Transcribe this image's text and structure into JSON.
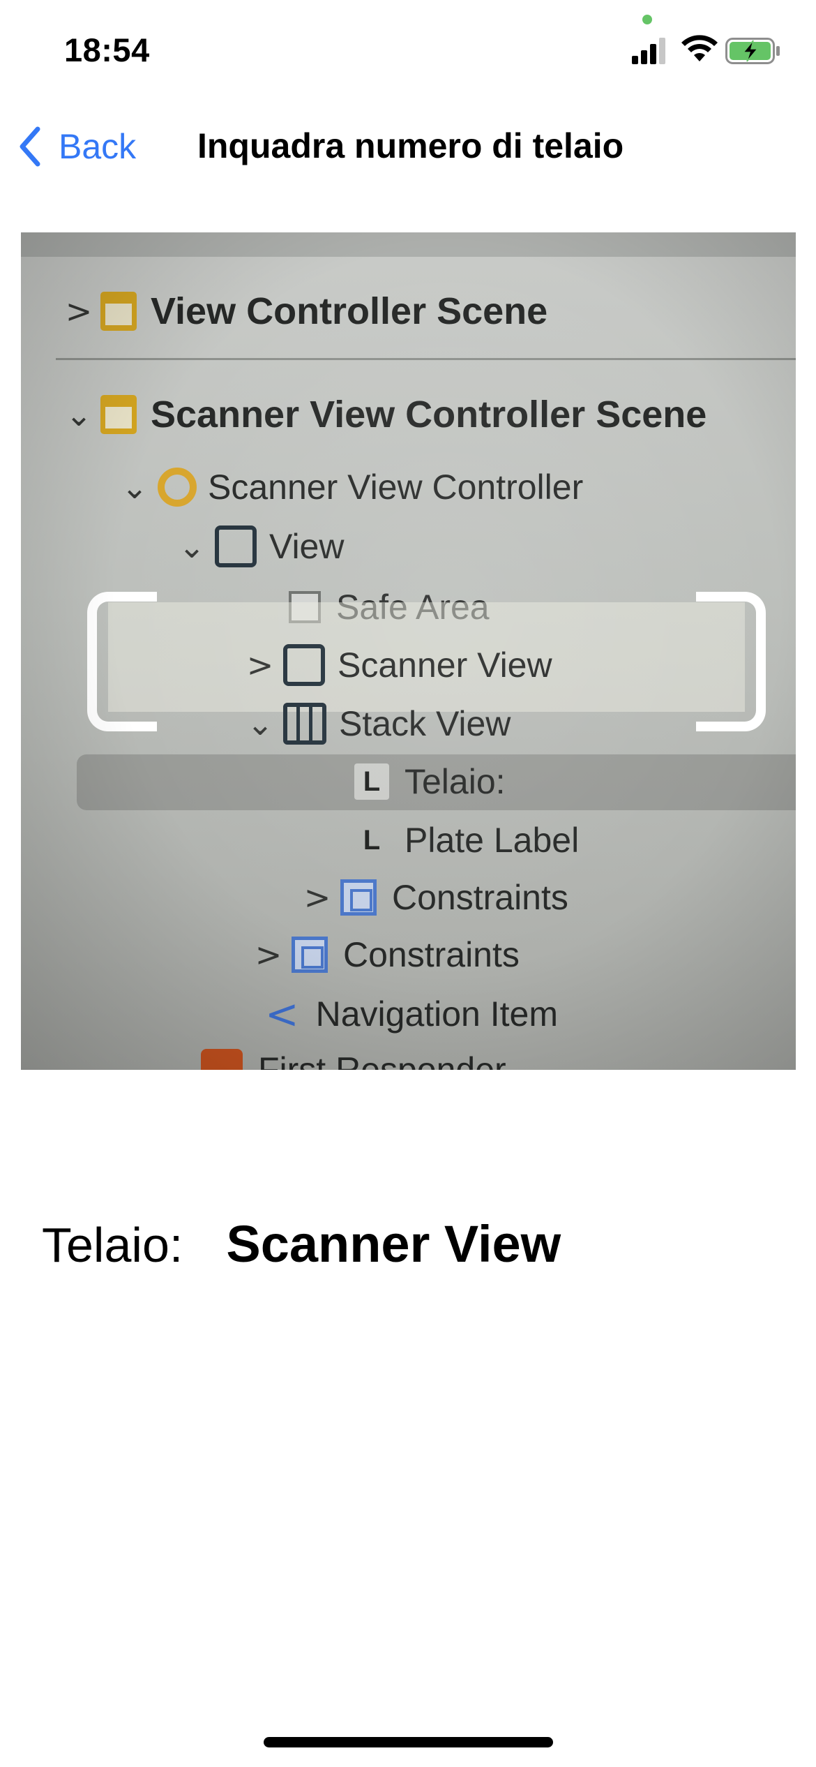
{
  "status_bar": {
    "time": "18:54",
    "signal_icon": "cellular-signal-icon",
    "wifi_icon": "wifi-icon",
    "battery_icon": "battery-charging-icon",
    "battery_color": "#65c466",
    "privacy_dot_color": "#65c466"
  },
  "nav": {
    "back_label": "Back",
    "back_icon": "chevron-left-icon",
    "title": "Inquadra numero di telaio",
    "accent_color": "#3478f6"
  },
  "camera_preview": {
    "rows": [
      {
        "chevron": ">",
        "icon": "scene-icon",
        "label": "View Controller Scene"
      },
      {
        "chevron": "⌄",
        "icon": "scene-icon",
        "label": "Scanner View Controller Scene"
      },
      {
        "chevron": "⌄",
        "icon": "view-controller-icon",
        "label": "Scanner View Controller"
      },
      {
        "chevron": "⌄",
        "icon": "view-icon",
        "label": "View"
      },
      {
        "chevron": "",
        "icon": "safe-area-icon",
        "label": "Safe Area"
      },
      {
        "chevron": ">",
        "icon": "view-icon",
        "label": "Scanner View"
      },
      {
        "chevron": "⌄",
        "icon": "stack-view-icon",
        "label": "Stack View"
      },
      {
        "chevron": "",
        "icon": "label-icon",
        "icon_text": "L",
        "label": "Telaio:"
      },
      {
        "chevron": "",
        "icon": "label-icon",
        "icon_text": "L",
        "label": "Plate Label"
      },
      {
        "chevron": ">",
        "icon": "constraints-icon",
        "label": "Constraints"
      },
      {
        "chevron": ">",
        "icon": "constraints-icon",
        "label": "Constraints"
      },
      {
        "chevron": "",
        "icon": "navigation-item-icon",
        "icon_text": "<",
        "label": "Navigation Item"
      },
      {
        "chevron": "",
        "icon": "first-responder-icon",
        "label": "First Responder"
      }
    ]
  },
  "result": {
    "label": "Telaio:",
    "value": "Scanner View"
  }
}
